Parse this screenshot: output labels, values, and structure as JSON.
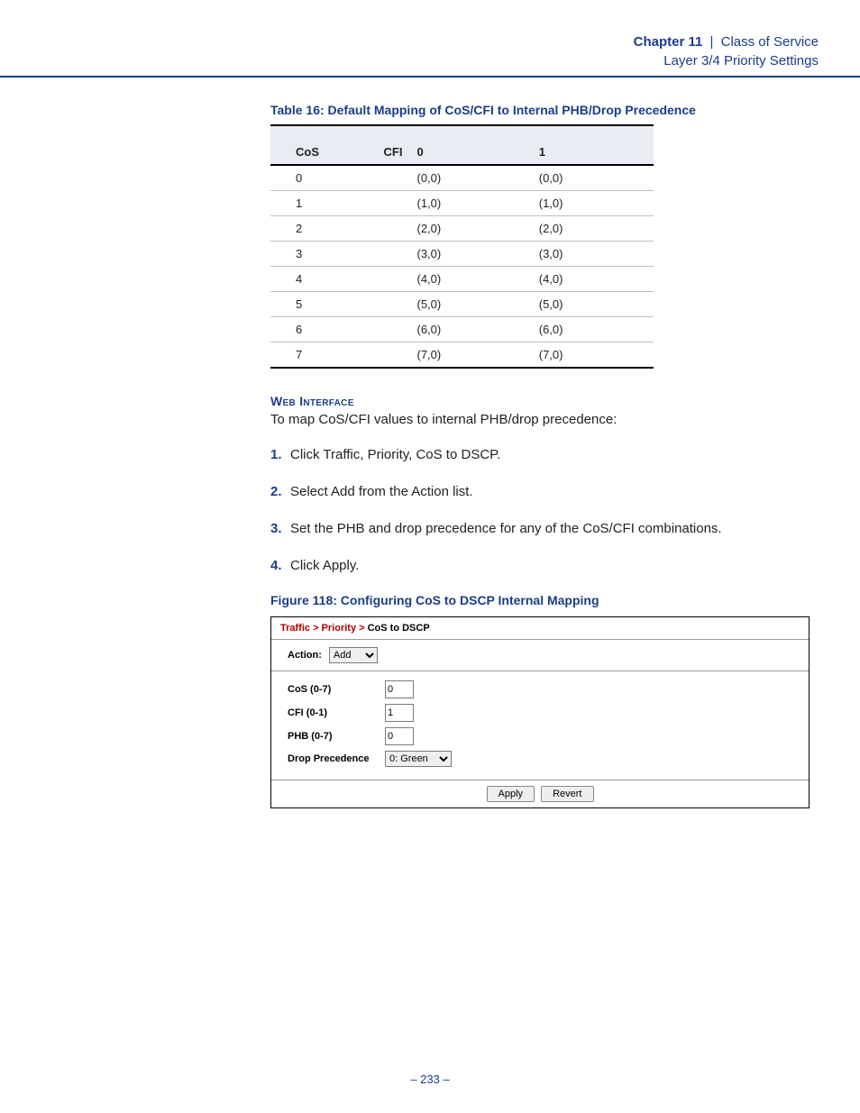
{
  "header": {
    "chapter": "Chapter 11",
    "sep": "|",
    "title": "Class of Service",
    "subtitle": "Layer 3/4 Priority Settings"
  },
  "table": {
    "caption": "Table 16: Default Mapping of CoS/CFI to Internal PHB/Drop Precedence",
    "head_cos": "CoS",
    "head_cfi": "CFI",
    "head_c0": "0",
    "head_c1": "1",
    "rows": [
      {
        "cos": "0",
        "c0": "(0,0)",
        "c1": "(0,0)"
      },
      {
        "cos": "1",
        "c0": "(1,0)",
        "c1": "(1,0)"
      },
      {
        "cos": "2",
        "c0": "(2,0)",
        "c1": "(2,0)"
      },
      {
        "cos": "3",
        "c0": "(3,0)",
        "c1": "(3,0)"
      },
      {
        "cos": "4",
        "c0": "(4,0)",
        "c1": "(4,0)"
      },
      {
        "cos": "5",
        "c0": "(5,0)",
        "c1": "(5,0)"
      },
      {
        "cos": "6",
        "c0": "(6,0)",
        "c1": "(6,0)"
      },
      {
        "cos": "7",
        "c0": "(7,0)",
        "c1": "(7,0)"
      }
    ]
  },
  "section_head": "Web Interface",
  "intro": "To map CoS/CFI values to internal PHB/drop precedence:",
  "steps": [
    "Click Traffic, Priority, CoS to DSCP.",
    "Select Add from the Action list.",
    "Set the PHB and drop precedence for any of the CoS/CFI combinations.",
    "Click Apply."
  ],
  "figure_caption": "Figure 118:  Configuring CoS to DSCP Internal Mapping",
  "panel": {
    "crumb_red": "Traffic > Priority >",
    "crumb_tail": "CoS to DSCP",
    "action_label": "Action:",
    "action_value": "Add",
    "fields": {
      "cos_label": "CoS (0-7)",
      "cos_value": "0",
      "cfi_label": "CFI (0-1)",
      "cfi_value": "1",
      "phb_label": "PHB (0-7)",
      "phb_value": "0",
      "drop_label": "Drop Precedence",
      "drop_value": "0: Green"
    },
    "apply": "Apply",
    "revert": "Revert"
  },
  "page": "–  233  –"
}
